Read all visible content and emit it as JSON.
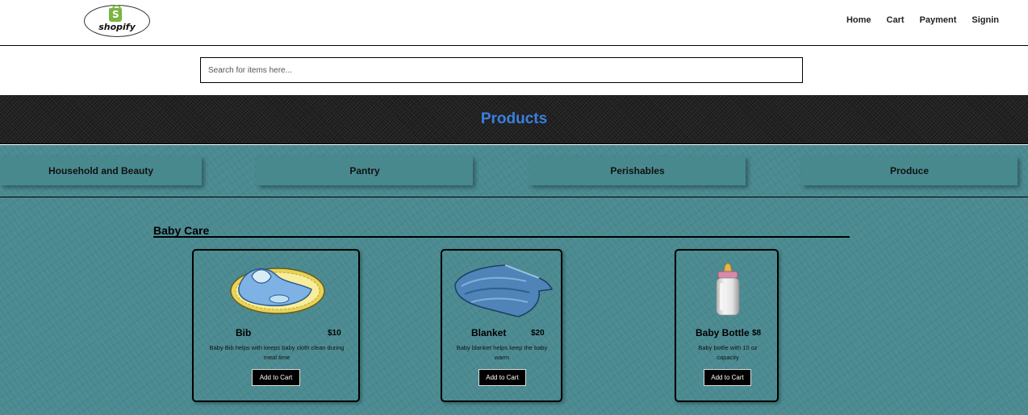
{
  "header": {
    "logo_text": "shopify",
    "logo_letter": "S",
    "nav": [
      "Home",
      "Cart",
      "Payment",
      "Signin"
    ]
  },
  "search": {
    "placeholder": "Search for items here..."
  },
  "banner": {
    "title": "Products"
  },
  "categories": [
    "Household and Beauty",
    "Pantry",
    "Perishables",
    "Produce"
  ],
  "section": {
    "title": "Baby Care"
  },
  "products": [
    {
      "name": "Bib",
      "price": "$10",
      "description": "Baby Bib helps with keeps baby cloth clean during meal time",
      "button": "Add to Cart",
      "icon": "bib-icon"
    },
    {
      "name": "Blanket",
      "price": "$20",
      "description": "Baby blanket helps keep the baby warm",
      "button": "Add to Cart",
      "icon": "blanket-icon"
    },
    {
      "name": "Baby Bottle",
      "price": "$8",
      "description": "Baby bottle with 10 oz capacity",
      "button": "Add to Cart",
      "icon": "baby-bottle-icon"
    }
  ],
  "colors": {
    "accent": "#3b7fe0",
    "teal": "#4a8a90",
    "banner": "#1f1f1f",
    "logo_green": "#7ab542"
  }
}
